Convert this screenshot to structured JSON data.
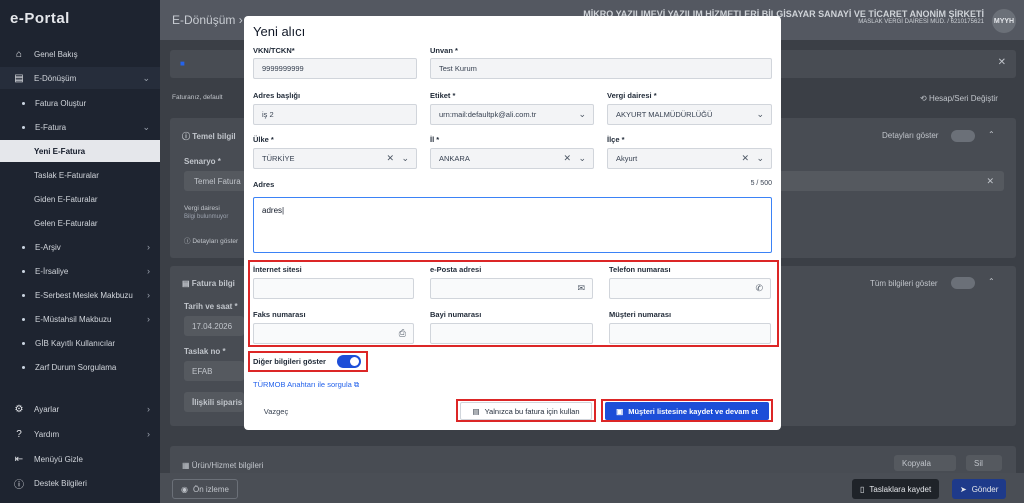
{
  "sidebar": {
    "logo": "e-Portal",
    "items": [
      {
        "label": "Genel Bakış",
        "icon": "home-icon"
      },
      {
        "label": "E-Dönüşüm",
        "icon": "document-icon"
      },
      {
        "label": "Fatura Oluştur"
      },
      {
        "label": "E-Fatura"
      },
      {
        "label": "Yeni E-Fatura"
      },
      {
        "label": "Taslak E-Faturalar"
      },
      {
        "label": "Giden E-Faturalar"
      },
      {
        "label": "Gelen E-Faturalar"
      },
      {
        "label": "E-Arşiv"
      },
      {
        "label": "E-İrsaliye"
      },
      {
        "label": "E-Serbest Meslek Makbuzu"
      },
      {
        "label": "E-Müstahsil Makbuzu"
      },
      {
        "label": "GİB Kayıtlı Kullanıcılar"
      },
      {
        "label": "Zarf Durum Sorgulama"
      },
      {
        "label": "Ayarlar",
        "icon": "gear-icon"
      },
      {
        "label": "Yardım",
        "icon": "help-icon"
      },
      {
        "label": "Menüyü Gizle",
        "icon": "collapse-menu-icon"
      },
      {
        "label": "Destek Bilgileri",
        "icon": "info-icon"
      }
    ]
  },
  "topbar": {
    "breadcrumb": "E-Dönüşüm",
    "company_name": "MİKRO YAZILIMEVİ YAZILIM HİZMETLERİ BİLGİSAYAR SANAYİ VE TİCARET ANONİM ŞİRKETİ",
    "company_tax": "MASLAK VERGİ DAİRESİ MÜD. / 6210175621",
    "avatar": "MYYH"
  },
  "background": {
    "info_text": "Faturanız, default",
    "account_change": "Hesap/Seri Değiştir",
    "temel_bilgiler": "Temel bilgil",
    "detaylari_goster": "Detayları göster",
    "senaryo_label": "Senaryo *",
    "senaryo_value": "Temel Fatura",
    "vergi_dairesi": "Vergi dairesi",
    "bilgi_bulunmuyor": "Bilgi bulunmuyor",
    "detaylari_goster_link": "Detayları göster",
    "fatura_bilgileri": "Fatura bilgi",
    "tum_bilgileri": "Tüm bilgileri göster",
    "tarih_saat": "Tarih ve saat *",
    "tarih_value": "17.04.2026",
    "taslak_no": "Taslak no *",
    "taslak_value": "EFAB",
    "iliskili": "İlişkili siparis",
    "urun_hizmet": "Ürün/Hizmet bilgileri",
    "kopyala": "Kopyala",
    "sil": "Sil"
  },
  "bottombar": {
    "preview": "Ön izleme",
    "save_draft": "Taslaklara kaydet",
    "send": "Gönder"
  },
  "modal": {
    "title": "Yeni alıcı",
    "vkn_label": "VKN/TCKN*",
    "vkn_value": "9999999999",
    "unvan_label": "Unvan *",
    "unvan_value": "Test Kurum",
    "adres_basligi_label": "Adres başlığı",
    "adres_basligi_value": "iş 2",
    "etiket_label": "Etiket *",
    "etiket_value": "urn:mail:defaultpk@ali.com.tr",
    "vergi_dairesi_label": "Vergi dairesi *",
    "vergi_dairesi_value": "AKYURT MALMÜDÜRLÜĞÜ",
    "ulke_label": "Ülke *",
    "ulke_value": "TÜRKİYE",
    "il_label": "İl *",
    "il_value": "ANKARA",
    "ilce_label": "İlçe *",
    "ilce_value": "Akyurt",
    "adres_label": "Adres",
    "adres_counter": "5 / 500",
    "adres_value": "adres",
    "internet_label": "İnternet sitesi",
    "eposta_label": "e-Posta adresi",
    "telefon_label": "Telefon numarası",
    "faks_label": "Faks numarası",
    "bayi_label": "Bayi numarası",
    "musteri_label": "Müşteri numarası",
    "diger_toggle": "Diğer bilgileri göster",
    "turmob_link": "TÜRMOB Anahtarı ile sorgula",
    "cancel": "Vazgeç",
    "only_this": "Yalnızca bu fatura için kullan",
    "save_continue": "Müşteri listesine kaydet ve devam et"
  },
  "colors": {
    "primary": "#1d4ed8",
    "highlight": "#dc2626",
    "sidebar": "#1e2430"
  }
}
